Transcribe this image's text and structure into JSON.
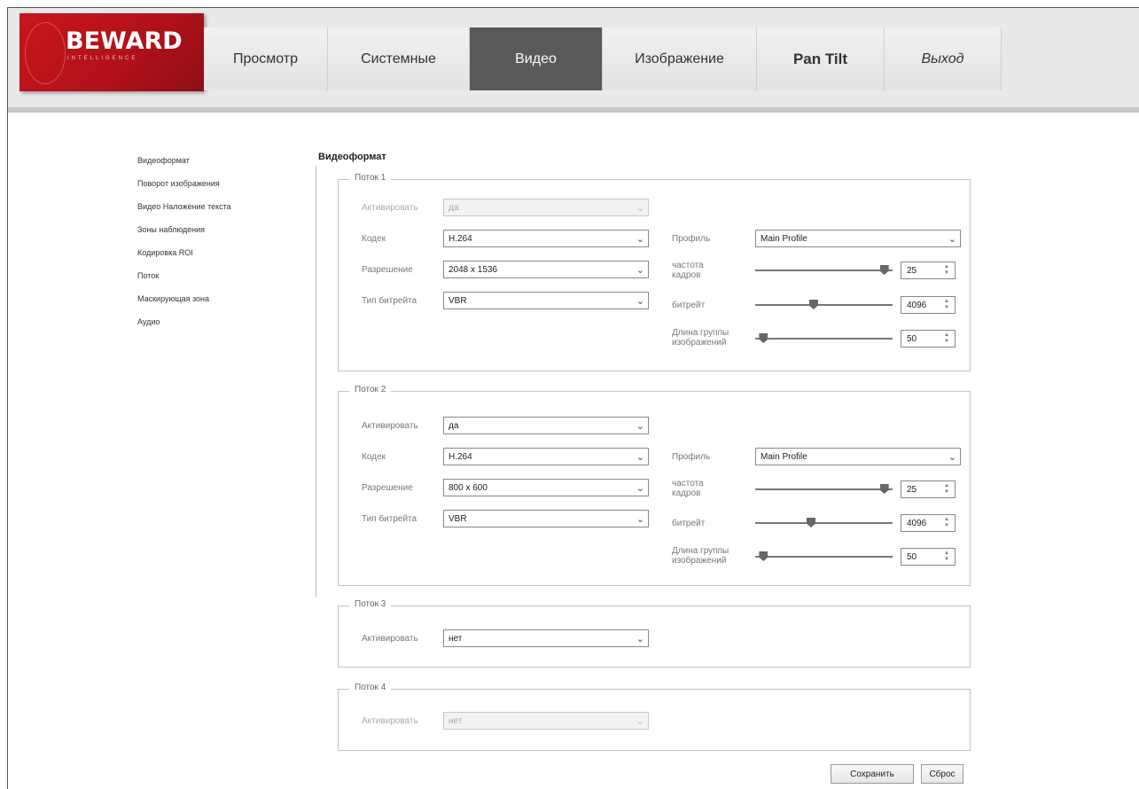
{
  "logo": {
    "brand": "BEWARD",
    "tagline": "INTELLIGENCE"
  },
  "nav": [
    "Просмотр",
    "Системные",
    "Видео",
    "Изображение",
    "Pan Tilt",
    "Выход"
  ],
  "sidebar": [
    "Видеоформат",
    "Поворот изображения",
    "Видео Наложение текста",
    "Зоны наблюдения",
    "Кодировка ROI",
    "Поток",
    "Маскирующая зона",
    "Аудио"
  ],
  "page_title": "Видеоформат",
  "labels": {
    "activate": "Активировать",
    "codec": "Кодек",
    "resolution": "Разрешение",
    "bitrate_type": "Тип битрейта",
    "profile": "Профиль",
    "framerate": "частота кадров",
    "bitrate": "битрейт",
    "gop": "Длина группы изображений"
  },
  "streams": [
    {
      "legend": "Поток 1",
      "activate": "да",
      "codec": "H.264",
      "resolution": "2048 x 1536",
      "bitrate_type": "VBR",
      "profile": "Main Profile",
      "framerate": "25",
      "bitrate": "4096",
      "gop": "50",
      "framerate_level": 0.97,
      "bitrate_level": 0.42,
      "gop_level": 0.03
    },
    {
      "legend": "Поток 2",
      "activate": "да",
      "codec": "H.264",
      "resolution": "800 x 600",
      "bitrate_type": "VBR",
      "profile": "Main Profile",
      "framerate": "25",
      "bitrate": "4096",
      "gop": "50",
      "framerate_level": 0.97,
      "bitrate_level": 0.4,
      "gop_level": 0.03
    },
    {
      "legend": "Поток 3",
      "activate": "нет"
    },
    {
      "legend": "Поток 4",
      "activate": "нет"
    }
  ],
  "buttons": {
    "save": "Сохранить",
    "reset": "Сброс"
  }
}
